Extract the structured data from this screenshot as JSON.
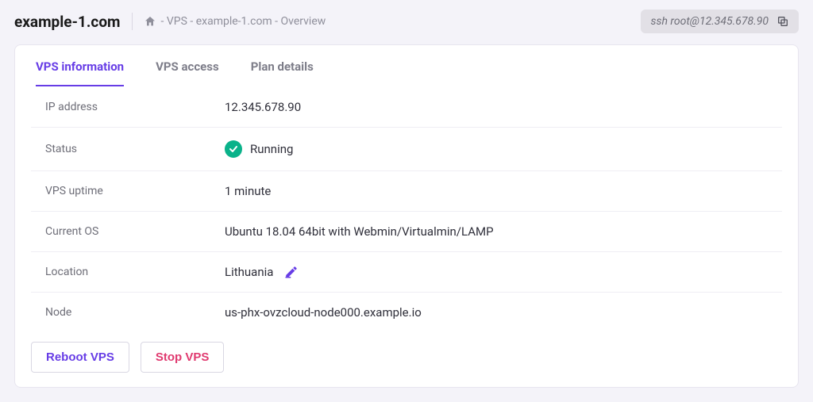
{
  "header": {
    "site": "example-1.com",
    "breadcrumb": " - VPS  - example-1.com - Overview",
    "ssh": "ssh root@12.345.678.90"
  },
  "tabs": [
    {
      "label": "VPS information",
      "active": true
    },
    {
      "label": "VPS access",
      "active": false
    },
    {
      "label": "Plan details",
      "active": false
    }
  ],
  "info": {
    "ip_label": "IP address",
    "ip": "12.345.678.90",
    "status_label": "Status",
    "status": "Running",
    "uptime_label": "VPS uptime",
    "uptime": "1 minute",
    "os_label": "Current OS",
    "os": "Ubuntu 18.04 64bit with Webmin/Virtualmin/LAMP",
    "location_label": "Location",
    "location": "Lithuania",
    "node_label": "Node",
    "node": "us-phx-ovzcloud-node000.example.io"
  },
  "actions": {
    "reboot": "Reboot VPS",
    "stop": "Stop VPS"
  }
}
